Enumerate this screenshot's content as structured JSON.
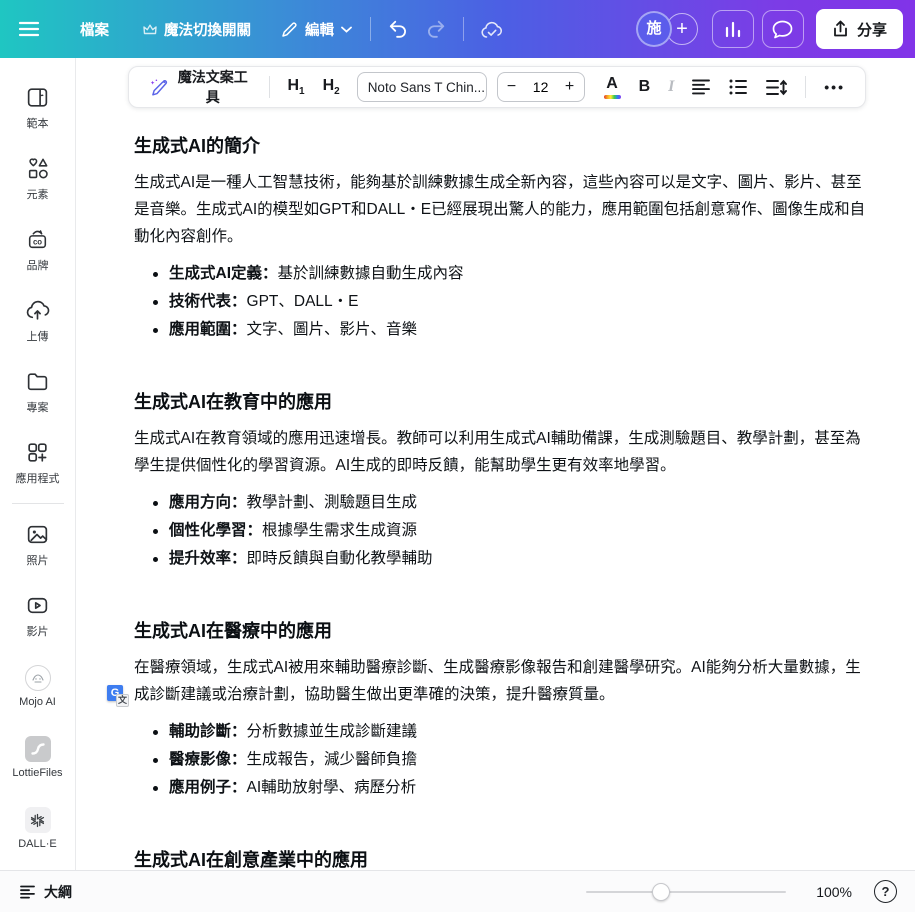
{
  "topbar": {
    "file_label": "檔案",
    "magic_switch_label": "魔法切換開關",
    "edit_label": "編輯",
    "avatar_text": "施",
    "plus_label": "+",
    "share_label": "分享",
    "icons": [
      "hamburger-menu-icon",
      "crown-icon",
      "pencil-icon",
      "chevron-down-icon",
      "undo-icon",
      "redo-icon",
      "cloud-sync-icon",
      "insights-chart-icon",
      "comments-icon",
      "share-upload-icon"
    ],
    "colors": {
      "gradient_left": "#1fc6c2",
      "gradient_mid": "#4c5fe4",
      "gradient_right": "#8133e8",
      "avatar_bg": "#5b5ceb"
    }
  },
  "toolbar": {
    "magic_write_label": "魔法文案工具",
    "h1_label": "H",
    "h1_sub": "1",
    "h2_label": "H",
    "h2_sub": "2",
    "font_name": "Noto Sans T Chin...",
    "minus_label": "−",
    "font_size": "12",
    "plus_label": "+",
    "color_label": "A",
    "bold_label": "B",
    "italic_label": "I",
    "more_label": "•••",
    "icons": [
      "magic-pen-icon",
      "align-left-icon",
      "bullet-list-icon",
      "line-spacing-icon"
    ]
  },
  "sidebar": {
    "items": [
      {
        "label": "範本",
        "icon": "templates-icon"
      },
      {
        "label": "元素",
        "icon": "elements-icon"
      },
      {
        "label": "品牌",
        "icon": "brand-icon",
        "badge_text": "co"
      },
      {
        "label": "上傳",
        "icon": "uploads-icon"
      },
      {
        "label": "專案",
        "icon": "projects-icon"
      },
      {
        "label": "應用程式",
        "icon": "apps-icon"
      },
      {
        "label": "照片",
        "icon": "photos-icon"
      },
      {
        "label": "影片",
        "icon": "videos-icon"
      },
      {
        "label": "Mojo AI",
        "icon": "mojo-ai-icon"
      },
      {
        "label": "LottieFiles",
        "icon": "lottiefiles-icon"
      },
      {
        "label": "DALL·E",
        "icon": "dalle-icon"
      }
    ]
  },
  "document": {
    "sections": [
      {
        "heading": "生成式AI的簡介",
        "paragraph": " 生成式AI是一種人工智慧技術，能夠基於訓練數據生成全新內容，這些內容可以是文字、圖片、影片、甚至是音樂。生成式AI的模型如GPT和DALL・E已經展現出驚人的能力，應用範圍包括創意寫作、圖像生成和自動化內容創作。",
        "bullets": [
          {
            "term": "生成式AI定義：",
            "text": "基於訓練數據自動生成內容"
          },
          {
            "term": "技術代表：",
            "text": "GPT、DALL・E"
          },
          {
            "term": "應用範圍：",
            "text": "文字、圖片、影片、音樂"
          }
        ]
      },
      {
        "heading": "生成式AI在教育中的應用",
        "paragraph": " 生成式AI在教育領域的應用迅速增長。教師可以利用生成式AI輔助備課，生成測驗題目、教學計劃，甚至為學生提供個性化的學習資源。AI生成的即時反饋，能幫助學生更有效率地學習。",
        "bullets": [
          {
            "term": "應用方向：",
            "text": "教學計劃、測驗題目生成"
          },
          {
            "term": "個性化學習：",
            "text": "根據學生需求生成資源"
          },
          {
            "term": "提升效率：",
            "text": "即時反饋與自動化教學輔助"
          }
        ]
      },
      {
        "heading": "生成式AI在醫療中的應用",
        "paragraph": "在醫療領域，生成式AI被用來輔助醫療診斷、生成醫療影像報告和創建醫學研究。AI能夠分析大量數據，生成診斷建議或治療計劃，協助醫生做出更準確的決策，提升醫療質量。",
        "has_translate_badge": true,
        "translate_badge": {
          "g": "G",
          "wen": "文"
        },
        "bullets": [
          {
            "term": "輔助診斷：",
            "text": "分析數據並生成診斷建議"
          },
          {
            "term": "醫療影像：",
            "text": "生成報告，減少醫師負擔"
          },
          {
            "term": "應用例子：",
            "text": "AI輔助放射學、病歷分析"
          }
        ]
      }
    ],
    "partial_heading": "生成式AI在創意產業中的應用"
  },
  "bottombar": {
    "outline_label": "大綱",
    "zoom_value": "100%",
    "zoom_thumb_percent": 33,
    "help_label": "?",
    "icons": [
      "outline-icon",
      "zoom-slider",
      "help-icon"
    ]
  }
}
